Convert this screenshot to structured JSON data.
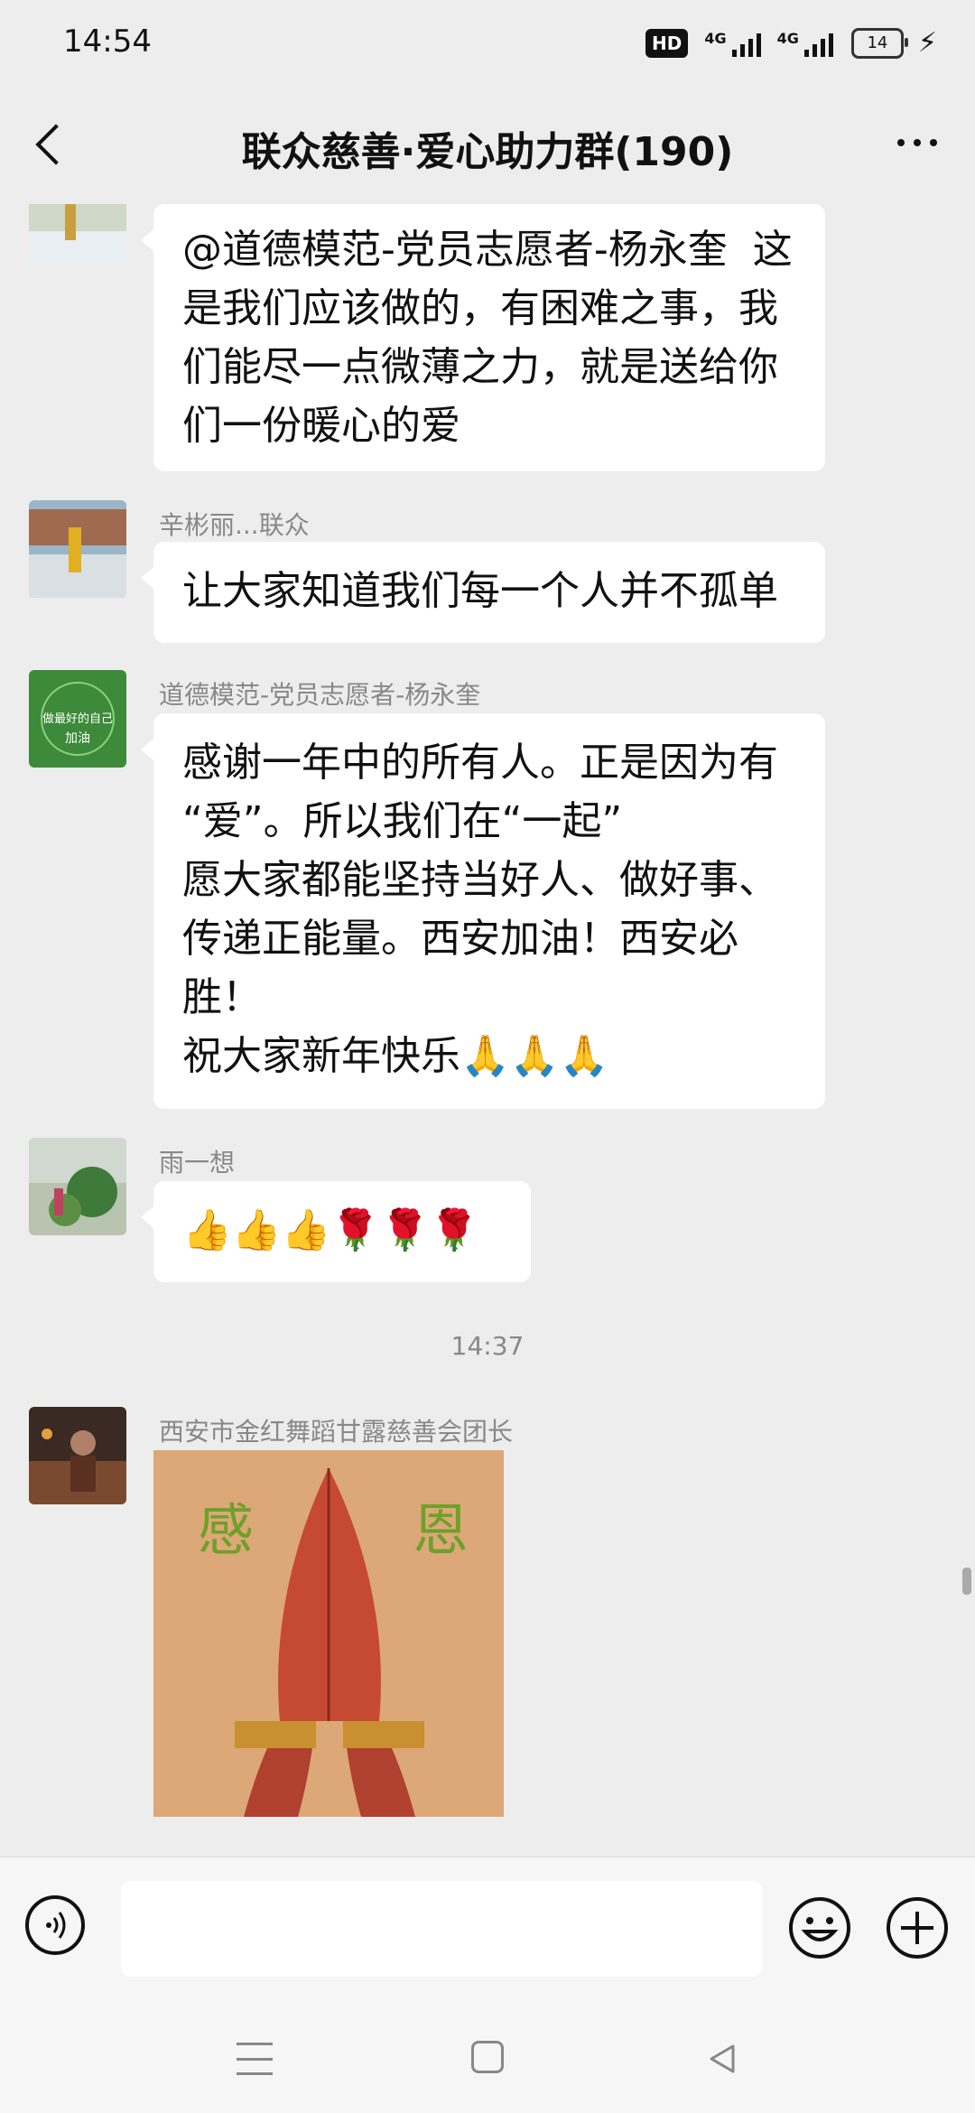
{
  "status_bar": {
    "time": "14:54",
    "hd_label": "HD",
    "network_1": "4G",
    "network_2": "4G",
    "battery": "14"
  },
  "header": {
    "title": "联众慈善·爱心助力群(190)"
  },
  "messages": [
    {
      "sender": "",
      "lines": [
        "@道德模范-党员志愿者-杨永奎  这",
        "是我们应该做的，有困难之事，我",
        "们能尽一点微薄之力，就是送给你",
        "们一份暖心的爱"
      ]
    },
    {
      "sender": "辛彬丽...联众",
      "lines": [
        "让大家知道我们每一个人并不孤单"
      ]
    },
    {
      "sender": "道德模范-党员志愿者-杨永奎",
      "avatar_text": [
        "做最好的自己",
        "加油"
      ],
      "lines": [
        "感谢一年中的所有人。正是因为有",
        "“爱”。所以我们在“一起”",
        "愿大家都能坚持当好人、做好事、",
        "传递正能量。西安加油！西安必",
        "胜！",
        "祝大家新年快乐🙏🙏🙏"
      ]
    },
    {
      "sender": "雨一想",
      "emojis": "👍👍👍🌹🌹🌹"
    },
    {
      "sender": "西安市金红舞蹈甘露慈善会团长",
      "image_text": [
        "感",
        "恩"
      ]
    }
  ],
  "timestamp": "14:37",
  "icons": {
    "back": "chevron-left-icon",
    "more": "more-dots-icon",
    "voice": "voice-icon",
    "emoji": "emoji-icon",
    "plus": "plus-icon"
  },
  "colors": {
    "background": "#ededed",
    "bubble": "#ffffff",
    "sender_text": "#888888"
  }
}
